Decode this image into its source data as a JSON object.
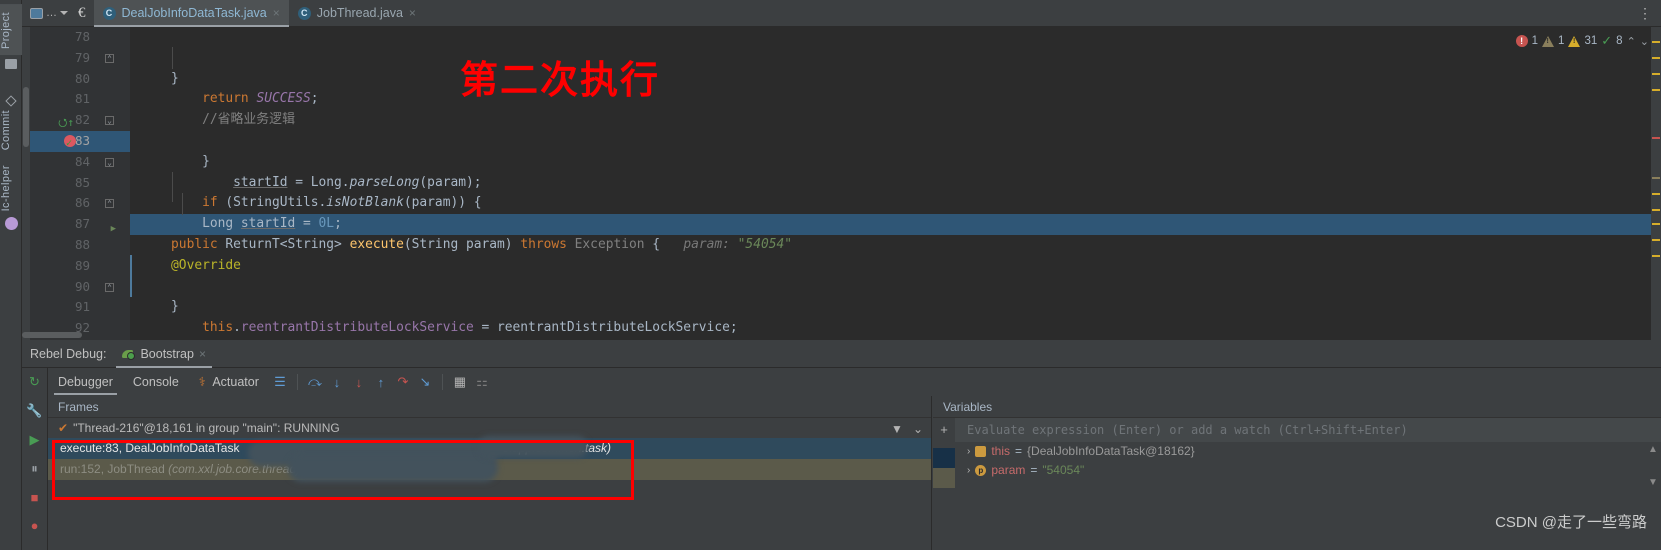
{
  "window": {
    "project_chip": "…",
    "euro_icon": "€"
  },
  "sidebar": {
    "items": [
      {
        "label": "Project",
        "icon": "folder-icon"
      },
      {
        "label": "Commit",
        "icon": "diamond-icon"
      },
      {
        "label": "Ic-helper",
        "icon": "circle-icon"
      }
    ]
  },
  "tabs": [
    {
      "label": "DealJobInfoDataTask.java",
      "icon": "class-icon",
      "active": true,
      "close": "×"
    },
    {
      "label": "JobThread.java",
      "icon": "class-locked-icon",
      "active": false,
      "close": "×"
    }
  ],
  "editor": {
    "overlay_text": "第二次执行",
    "status": {
      "error_count": "1",
      "warning_count": "1",
      "weak_warning_count": "31",
      "ok_count": "8",
      "chevron_up": "⌃",
      "chevron_down": "⌄",
      "error_glyph": "!",
      "ok_glyph": "✓"
    },
    "lines": [
      {
        "n": "78",
        "current": false,
        "fold": "",
        "html": "        <span class='kw'>this</span>.<span class='fld'>reentrantDistributeLockService</span> = reentrantDistributeLockService;"
      },
      {
        "n": "79",
        "current": false,
        "fold": "up",
        "html": "    }"
      },
      {
        "n": "80",
        "current": false,
        "fold": "",
        "html": ""
      },
      {
        "n": "81",
        "current": false,
        "fold": "",
        "html": "    <span class='ann'>@Override</span>"
      },
      {
        "n": "82",
        "current": false,
        "fold": "dn",
        "html": "    <span class='kw'>public</span> ReturnT&lt;String&gt; <span class='mtd'>execute</span>(String param) <span class='kw'>throws</span> <span class='cmt'>Exception</span> {   <span class='param-hint'>param:</span> <span class='str-hint'>\"54054\"</span>"
      },
      {
        "n": "83",
        "current": true,
        "fold": "",
        "html": "        Long <span class='und'>startId</span> = <span class='num'>0L</span>;"
      },
      {
        "n": "84",
        "current": false,
        "fold": "dn",
        "html": "        <span class='kw'>if</span> (StringUtils.<span class='ital'>isNotBlank</span>(param)) {"
      },
      {
        "n": "85",
        "current": false,
        "fold": "",
        "html": "            <span class='und'>startId</span> = Long.<span class='ital'>parseLong</span>(param);"
      },
      {
        "n": "86",
        "current": false,
        "fold": "up",
        "html": "        }"
      },
      {
        "n": "87",
        "current": false,
        "fold": "run",
        "html": ""
      },
      {
        "n": "88",
        "current": false,
        "fold": "",
        "html": "        <span class='cmt'>//省略业务逻辑</span>"
      },
      {
        "n": "89",
        "current": false,
        "fold": "",
        "html": "        <span class='kw'>return</span> <span class='fld ital'>SUCCESS</span>;"
      },
      {
        "n": "90",
        "current": false,
        "fold": "up",
        "html": "    }"
      },
      {
        "n": "91",
        "current": false,
        "fold": "",
        "html": ""
      },
      {
        "n": "92",
        "current": false,
        "fold": "",
        "html": ""
      }
    ]
  },
  "rebel": {
    "label": "Rebel Debug:",
    "tab_label": "Bootstrap",
    "close": "×"
  },
  "debug_toolbar": {
    "tabs": [
      {
        "label": "Debugger",
        "active": true
      },
      {
        "label": "Console",
        "active": false
      },
      {
        "label": "Actuator",
        "active": false,
        "icon": "actuator-icon"
      }
    ],
    "icons": [
      "layout-icon",
      "step-over-icon",
      "step-into-icon",
      "force-step-into-icon",
      "step-out-icon",
      "drop-frame-icon",
      "run-to-cursor-icon",
      "evaluate-icon",
      "settings-icon"
    ]
  },
  "debug_left_icons": [
    "rerun-icon",
    "wrench-icon",
    "resume-icon",
    "pause-icon",
    "stop-icon",
    "mute-breakpoints-icon"
  ],
  "frames": {
    "header": "Frames",
    "thread": "\"Thread-216\"@18,161 in group \"main\": RUNNING",
    "rows": [
      {
        "method": "execute:83, DealJobInfoDataTask",
        "package": "s.app.common.task)",
        "selected": true
      },
      {
        "method": "run:152, JobThread",
        "package": "(com.xxl.job.core.thread)",
        "selected": false
      }
    ],
    "filter_icon": "funnel-icon",
    "dropdown_icon": "chevron-down-icon"
  },
  "variables": {
    "header": "Variables",
    "evaluate_placeholder": "Evaluate expression (Enter) or add a watch (Ctrl+Shift+Enter)",
    "add_icon": "+",
    "remove_icon": "−",
    "filter_icon": "funnel-icon",
    "rows": [
      {
        "expander": "›",
        "icon": "object-icon",
        "icon_glyph": "",
        "name": "this",
        "eq": "=",
        "value": "{DealJobInfoDataTask@18162}",
        "value_kind": "obj"
      },
      {
        "expander": "›",
        "icon": "param-icon",
        "icon_glyph": "p",
        "name": "param",
        "eq": "=",
        "value": "\"54054\"",
        "value_kind": "str"
      }
    ],
    "scroll_up": "▲",
    "scroll_down": "▼"
  },
  "watermark": "CSDN @走了一些弯路",
  "colors": {
    "accent_blue": "#2f5676",
    "red_box": "#ff0000",
    "overlay_red": "#ff0000",
    "bg_editor": "#2b2b2b",
    "bg_panel": "#3c3f41"
  }
}
